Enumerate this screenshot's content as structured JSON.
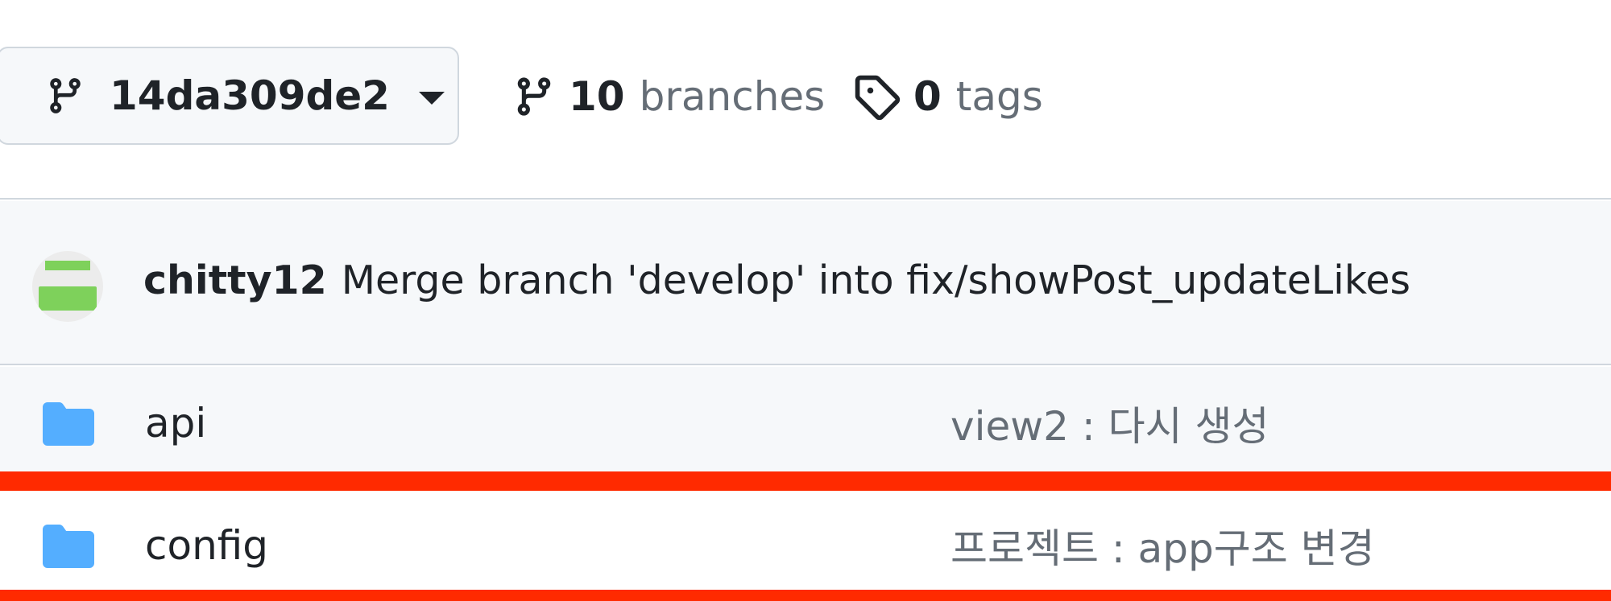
{
  "header": {
    "branch_selector": {
      "label": "14da309de2",
      "icon": "git-branch-icon"
    },
    "branches": {
      "count": "10",
      "label": "branches",
      "icon": "git-branch-icon"
    },
    "tags": {
      "count": "0",
      "label": "tags",
      "icon": "tag-icon"
    }
  },
  "commit": {
    "author": "chitty12",
    "message": "Merge branch 'develop' into fix/showPost_updateLikes"
  },
  "files": [
    {
      "name": "api",
      "message": "view2 : 다시 생성",
      "icon": "folder-icon"
    },
    {
      "name": "config",
      "message": "프로젝트 : app구조 변경",
      "icon": "folder-icon"
    }
  ],
  "colors": {
    "highlight": "#ff2a00",
    "folder": "#54aeff",
    "avatar_green": "#7ed15b"
  }
}
